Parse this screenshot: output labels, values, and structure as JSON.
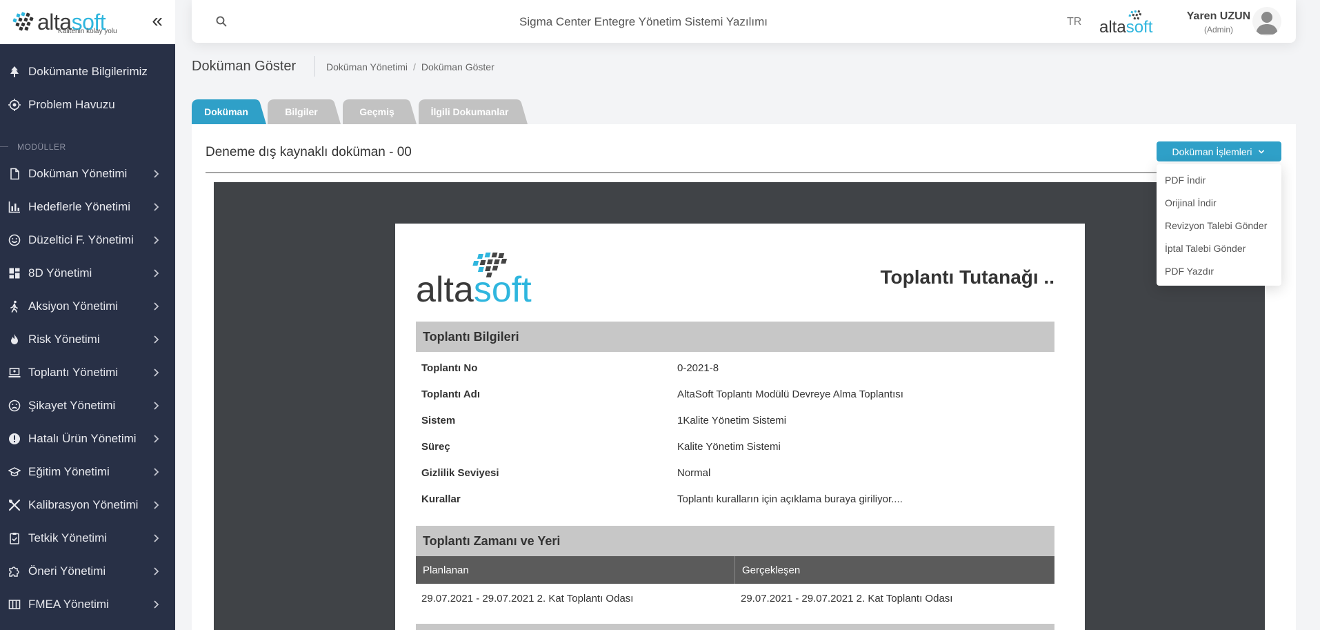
{
  "brand": {
    "name_part1": "alta",
    "name_part2": "soft",
    "tagline": "Kalitenin kolay yolu",
    "collapse_glyph": "«"
  },
  "sidebar": {
    "top_items": [
      {
        "label": "Dokümante Bilgilerimiz",
        "icon": "tree-icon"
      },
      {
        "label": "Problem Havuzu",
        "icon": "target-icon"
      }
    ],
    "section_label": "MODÜLLER",
    "items": [
      {
        "label": "Doküman Yönetimi",
        "icon": "file-icon"
      },
      {
        "label": "Hedeflerle Yönetimi",
        "icon": "bar-chart-icon"
      },
      {
        "label": "Düzeltici F. Yönetimi",
        "icon": "smile-icon"
      },
      {
        "label": "8D Yönetimi",
        "icon": "dashboard-icon"
      },
      {
        "label": "Aksiyon Yönetimi",
        "icon": "walking-icon"
      },
      {
        "label": "Risk Yönetimi",
        "icon": "fire-icon"
      },
      {
        "label": "Toplantı Yönetimi",
        "icon": "laptop-icon"
      },
      {
        "label": "Şikayet Yönetimi",
        "icon": "frown-icon"
      },
      {
        "label": "Hatalı Ürün Yönetimi",
        "icon": "alert-circle-icon"
      },
      {
        "label": "Eğitim Yönetimi",
        "icon": "graduation-cap-icon"
      },
      {
        "label": "Kalibrasyon Yönetimi",
        "icon": "tools-icon"
      },
      {
        "label": "Tetkik Yönetimi",
        "icon": "clipboard-check-icon"
      },
      {
        "label": "Öneri Yönetimi",
        "icon": "puzzle-icon"
      },
      {
        "label": "FMEA Yönetimi",
        "icon": "columns-icon"
      }
    ]
  },
  "topbar": {
    "app_title": "Sigma Center Entegre Yönetim Sistemi Yazılımı",
    "language": "TR",
    "user_name": "Yaren UZUN",
    "user_role": "(Admin)"
  },
  "page": {
    "title": "Doküman Göster",
    "breadcrumb": [
      "Doküman Yönetimi",
      "Doküman Göster"
    ],
    "breadcrumb_separator": "/"
  },
  "tabs": [
    "Doküman",
    "Bilgiler",
    "Geçmiş",
    "İlgili Dokumanlar"
  ],
  "document": {
    "title": "Deneme dış kaynaklı doküman - 00",
    "actions_label": "Doküman İşlemleri",
    "actions_menu": [
      "PDF İndir",
      "Orijinal İndir",
      "Revizyon Talebi Gönder",
      "İptal Talebi Gönder",
      "PDF Yazdır"
    ]
  },
  "paper": {
    "title": "Toplantı Tutanağı ..",
    "section1": "Toplantı Bilgileri",
    "info": [
      {
        "key": "Toplantı No",
        "value": "0-2021-8"
      },
      {
        "key": "Toplantı Adı",
        "value": "AltaSoft Toplantı Modülü Devreye Alma Toplantısı"
      },
      {
        "key": "Sistem",
        "value": "1Kalite Yönetim Sistemi"
      },
      {
        "key": "Süreç",
        "value": "Kalite Yönetim Sistemi"
      },
      {
        "key": "Gizlilik Seviyesi",
        "value": "Normal"
      },
      {
        "key": "Kurallar",
        "value": "Toplantı kuralların için açıklama buraya giriliyor...."
      }
    ],
    "section2": "Toplantı Zamanı ve Yeri",
    "columns": [
      "Planlanan",
      "Gerçekleşen"
    ],
    "time_row": [
      "29.07.2021 - 29.07.2021 2. Kat Toplantı Odası",
      "29.07.2021 - 29.07.2021 2. Kat Toplantı Odası"
    ]
  },
  "colors": {
    "sidebar_bg": "#283046",
    "accent": "#2fa0c8",
    "logo_blue": "#2fb6de",
    "tab_inactive": "#c2c2c2"
  }
}
